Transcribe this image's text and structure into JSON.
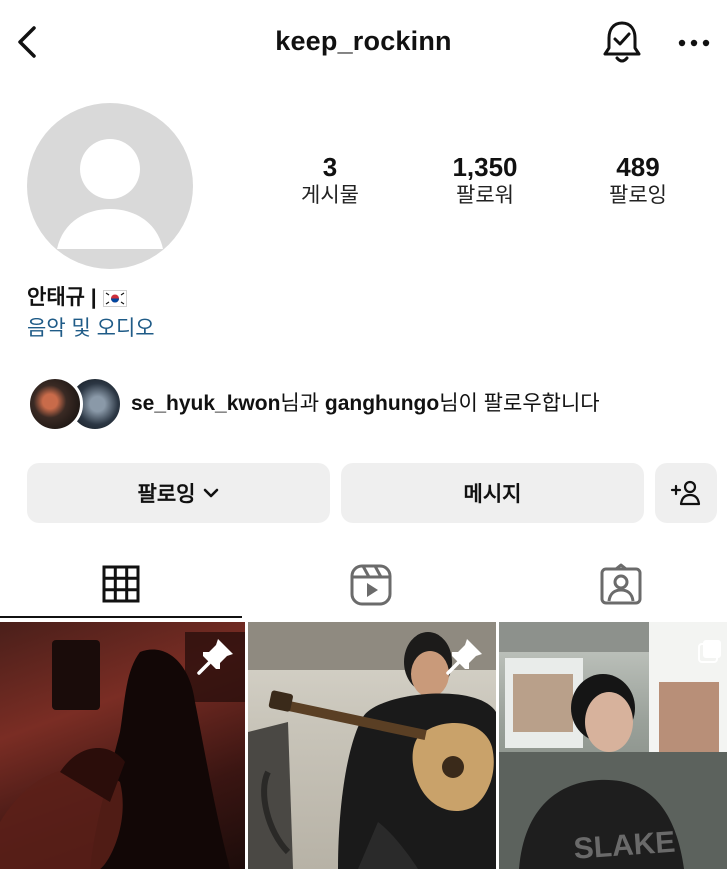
{
  "header": {
    "username": "keep_rockinn"
  },
  "profile": {
    "stats": [
      {
        "value": "3",
        "label": "게시물"
      },
      {
        "value": "1,350",
        "label": "팔로워"
      },
      {
        "value": "489",
        "label": "팔로잉"
      }
    ],
    "full_name": "안태규 |",
    "flag_icon": "south-korea-flag-icon",
    "category": "음악 및 오디오"
  },
  "mutual_followers": {
    "user1": "se_hyuk_kwon",
    "joiner": "님과 ",
    "user2": "ganghungo",
    "suffix": "님이 팔로우합니다"
  },
  "actions": {
    "following_label": "팔로잉",
    "message_label": "메시지"
  },
  "tabs": [
    {
      "icon": "grid-icon",
      "selected": true
    },
    {
      "icon": "reels-icon",
      "selected": false
    },
    {
      "icon": "tagged-icon",
      "selected": false
    }
  ],
  "posts": [
    {
      "pinned": true
    },
    {
      "pinned": true
    },
    {
      "pinned": false,
      "multi": true
    }
  ]
}
